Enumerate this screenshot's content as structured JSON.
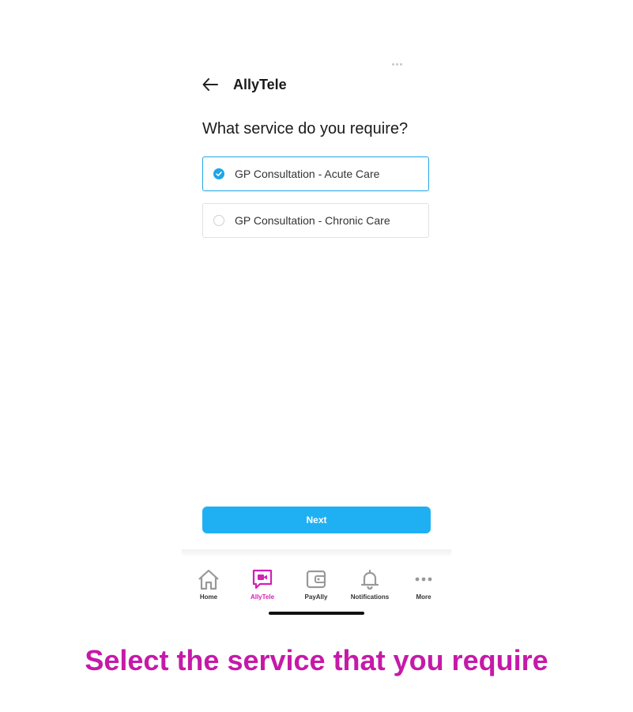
{
  "header": {
    "title": "AllyTele"
  },
  "question": "What service do you require?",
  "options": [
    {
      "label": "GP Consultation - Acute Care",
      "selected": true
    },
    {
      "label": "GP Consultation - Chronic Care",
      "selected": false
    }
  ],
  "next_button": "Next",
  "tabbar": {
    "items": [
      {
        "label": "Home",
        "icon": "home-icon",
        "active": false
      },
      {
        "label": "AllyTele",
        "icon": "video-chat-icon",
        "active": true
      },
      {
        "label": "PayAlly",
        "icon": "wallet-icon",
        "active": false
      },
      {
        "label": "Notifications",
        "icon": "bell-icon",
        "active": false
      },
      {
        "label": "More",
        "icon": "more-dots-icon",
        "active": false
      }
    ]
  },
  "caption": "Select the service that you require",
  "colors": {
    "accent": "#1fa5e8",
    "button": "#1fb0f4",
    "active_tab": "#d51fb4",
    "caption": "#c51aa8"
  }
}
